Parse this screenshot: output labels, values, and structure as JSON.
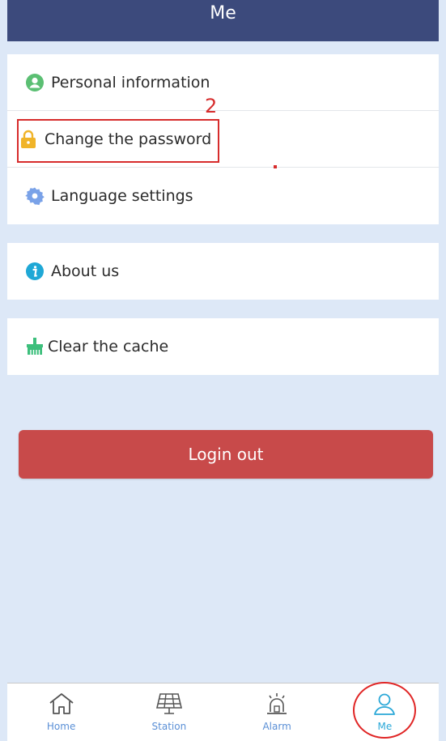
{
  "header": {
    "title": "Me"
  },
  "menu": {
    "personal_info": "Personal information",
    "change_password": "Change the password",
    "language_settings": "Language settings",
    "about_us": "About us",
    "clear_cache": "Clear the cache"
  },
  "annotation": {
    "step_number": "2"
  },
  "logout_label": "Login out",
  "tabs": [
    {
      "label": "Home",
      "icon": "home-icon"
    },
    {
      "label": "Station",
      "icon": "solar-panel-icon"
    },
    {
      "label": "Alarm",
      "icon": "alarm-siren-icon"
    },
    {
      "label": "Me",
      "icon": "user-icon"
    }
  ],
  "colors": {
    "header": "#3c4a7c",
    "background": "#dde8f7",
    "logout_button": "#c84a4a",
    "annotation": "#d72c2c",
    "tab_active": "#2aa8d8"
  }
}
